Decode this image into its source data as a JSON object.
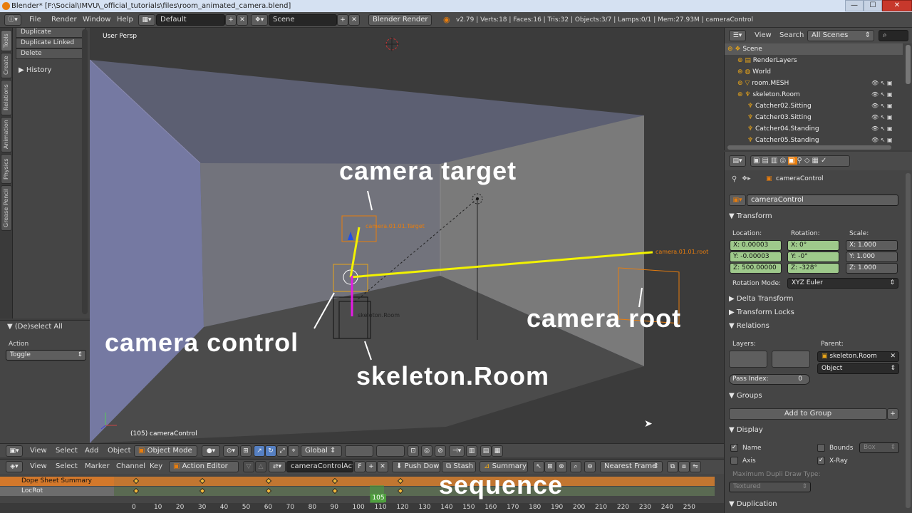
{
  "window": {
    "title": "Blender* [F:\\Social\\IMVU\\_official_tutorials\\files\\room_animated_camera.blend]",
    "minimize": "—",
    "maximize": "☐",
    "close": "✕"
  },
  "info_header": {
    "menus": [
      "File",
      "Render",
      "Window",
      "Help"
    ],
    "screen_layout": "Default",
    "scene": "Scene",
    "render_engine": "Blender Render",
    "stats": "v2.79 | Verts:18 | Faces:16 | Tris:32 | Objects:3/7 | Lamps:0/1 | Mem:27.93M | cameraControl"
  },
  "tool_tabs": [
    "Tools",
    "Create",
    "Relations",
    "Animation",
    "Physics",
    "Grease Pencil"
  ],
  "tool_panel": {
    "buttons": [
      "Duplicate",
      "Duplicate Linked",
      "Delete"
    ],
    "history": "History"
  },
  "operator_panel": {
    "title": "(De)select All",
    "action_label": "Action",
    "action_value": "Toggle"
  },
  "viewport": {
    "view_name": "User Persp",
    "status": "(105) cameraControl",
    "target_label": "camera.01.01.Target",
    "root_label": "camera.01.01.root",
    "skeleton_label": "skeleton.Room",
    "annotations": {
      "camera_target": "camera target",
      "camera_root": "camera root",
      "camera_control": "camera control",
      "skeleton_room": "skeleton.Room",
      "sequence": "sequence"
    }
  },
  "view3d_header": {
    "menus": [
      "View",
      "Select",
      "Add",
      "Object"
    ],
    "mode": "Object Mode",
    "orientation": "Global"
  },
  "dopesheet_header": {
    "menus": [
      "View",
      "Select",
      "Marker",
      "Channel",
      "Key"
    ],
    "editor": "Action Editor",
    "action": "cameraControlAction",
    "fake_user": "F",
    "push_down": "Push Down",
    "stash": "Stash",
    "summary": "Summary",
    "snap": "Nearest Frame"
  },
  "dopesheet": {
    "channels": [
      "Dope Sheet Summary",
      "LocRot"
    ],
    "current_frame": "105",
    "keyframes": [
      0,
      30,
      60,
      90,
      120
    ],
    "ruler": [
      "0",
      "10",
      "20",
      "30",
      "40",
      "50",
      "60",
      "70",
      "80",
      "90",
      "100",
      "110",
      "120",
      "130",
      "140",
      "150",
      "160",
      "170",
      "180",
      "190",
      "200",
      "210",
      "220",
      "230",
      "240",
      "250"
    ]
  },
  "outliner": {
    "menus": [
      "View",
      "Search"
    ],
    "filter": "All Scenes",
    "items": [
      {
        "label": "Scene",
        "level": 0
      },
      {
        "label": "RenderLayers",
        "level": 1
      },
      {
        "label": "World",
        "level": 1
      },
      {
        "label": "room.MESH",
        "level": 1
      },
      {
        "label": "skeleton.Room",
        "level": 1
      },
      {
        "label": "Catcher02.Sitting",
        "level": 2
      },
      {
        "label": "Catcher03.Sitting",
        "level": 2
      },
      {
        "label": "Catcher04.Standing",
        "level": 2
      },
      {
        "label": "Catcher05.Standing",
        "level": 2
      }
    ]
  },
  "properties": {
    "breadcrumb": "cameraControl",
    "object_name": "cameraControl",
    "transform": {
      "title": "Transform",
      "location_label": "Location:",
      "rotation_label": "Rotation:",
      "scale_label": "Scale:",
      "location": [
        "X:  0.00003",
        "Y:  -0.00003",
        "Z:  500.00000"
      ],
      "rotation": [
        "X:  0°",
        "Y:  -0°",
        "Z:  -328°"
      ],
      "scale": [
        "X:  1.000",
        "Y:  1.000",
        "Z:  1.000"
      ],
      "rotation_mode_label": "Rotation Mode:",
      "rotation_mode": "XYZ Euler"
    },
    "delta_transform": "Delta Transform",
    "transform_locks": "Transform Locks",
    "relations": {
      "title": "Relations",
      "layers_label": "Layers:",
      "parent_label": "Parent:",
      "parent": "skeleton.Room",
      "parent_type": "Object",
      "pass_index_label": "Pass Index:",
      "pass_index": "0"
    },
    "groups": {
      "title": "Groups",
      "add_button": "Add to Group"
    },
    "display": {
      "title": "Display",
      "name": "Name",
      "bounds": "Bounds",
      "bounds_type": "Box",
      "axis": "Axis",
      "xray": "X-Ray",
      "max_dupli_label": "Maximum Dupli Draw Type:",
      "max_dupli_value": "Textured"
    },
    "duplication": "Duplication"
  },
  "colors": {
    "accent": "#e87d0d",
    "selected_green": "#9ec98b",
    "summary_orange": "#d3782b",
    "camera_line": "#f2f200",
    "pink_line": "#e31ce3"
  }
}
